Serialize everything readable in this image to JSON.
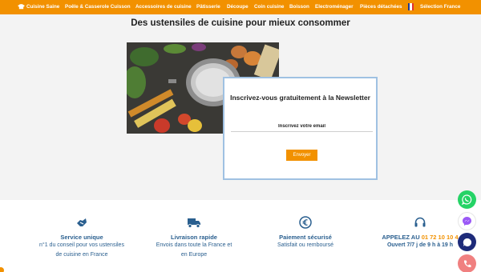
{
  "nav": {
    "items": [
      {
        "label": "Cuisine Saine"
      },
      {
        "label": "Poêle & Casserole Cuisson"
      },
      {
        "label": "Accessoires de cuisine"
      },
      {
        "label": "Pâtisserie"
      },
      {
        "label": "Découpe"
      },
      {
        "label": "Coin cuisine"
      },
      {
        "label": "Boisson"
      },
      {
        "label": "Electroménager"
      },
      {
        "label": "Pièces détachées"
      },
      {
        "label": "Sélection France"
      }
    ]
  },
  "headline": "Des ustensiles de cuisine pour mieux consommer",
  "newsletter": {
    "title": "Inscrivez-vous gratuitement à la Newsletter",
    "email_placeholder": "Inscrivez votre email",
    "button_label": "Envoyer"
  },
  "features": [
    {
      "title": "Service unique",
      "line1": "n°1 du conseil pour vos ustensiles",
      "line2": "de cuisine en France"
    },
    {
      "title": "Livraison rapide",
      "line1": "Envois dans toute la France et",
      "line2": "en Europe"
    },
    {
      "title": "Paiement sécurisé",
      "line1": "Satisfait ou remboursé"
    },
    {
      "title_prefix": "APPELEZ AU ",
      "phone": "01 72 10 10 4",
      "line1": "Ouvert 7/7 j de 9 h à 19 h"
    }
  ],
  "colors": {
    "accent": "#f29100",
    "feature_text": "#2a5f8f",
    "newsletter_border": "#9fc1e2",
    "whatsapp": "#25d366",
    "messenger": "#9b59f6",
    "chat": "#1e2b7a",
    "phone": "#f08080"
  },
  "icons": [
    "chef-hat-icon",
    "france-flag-icon",
    "handshake-icon",
    "truck-icon",
    "euro-coin-icon",
    "headset-icon",
    "whatsapp-icon",
    "messenger-icon",
    "chat-icon",
    "phone-icon"
  ]
}
